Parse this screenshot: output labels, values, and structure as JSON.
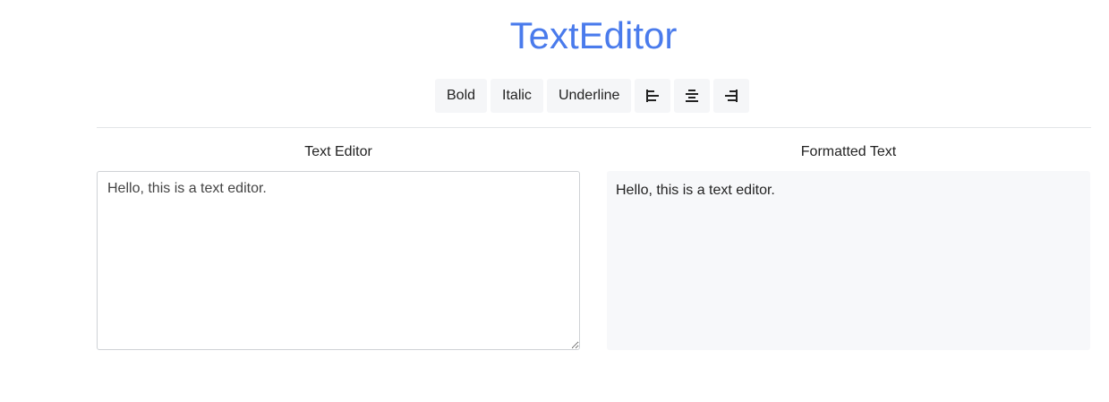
{
  "app": {
    "title": "TextEditor",
    "accent_color": "#4a7bec"
  },
  "toolbar": {
    "bold_label": "Bold",
    "italic_label": "Italic",
    "underline_label": "Underline",
    "align_left_icon": "align-left-icon",
    "align_center_icon": "align-center-icon",
    "align_right_icon": "align-right-icon"
  },
  "editor": {
    "label": "Text Editor",
    "value": "Hello, this is a text editor."
  },
  "preview": {
    "label": "Formatted Text",
    "content": "Hello, this is a text editor."
  }
}
